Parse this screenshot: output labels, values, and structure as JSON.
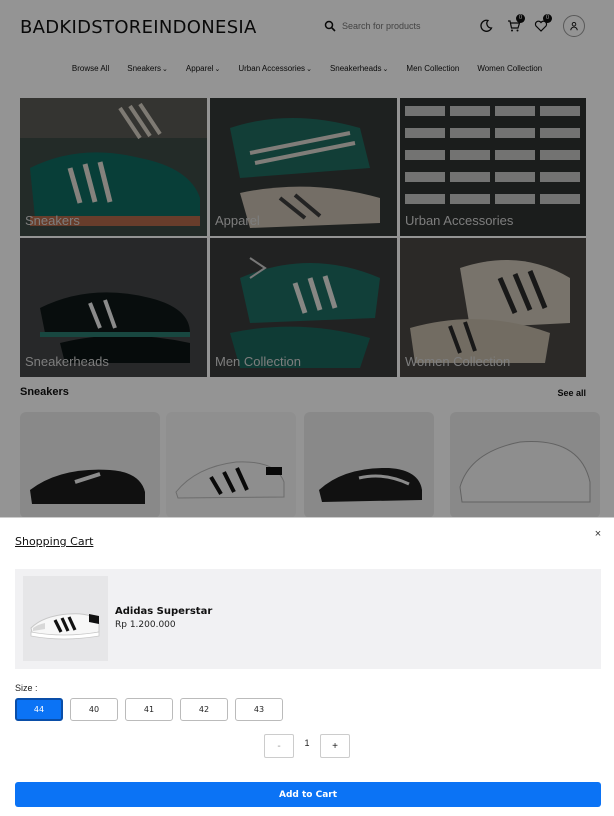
{
  "header": {
    "brand": "BADKIDSTOREINDONESIA",
    "search_placeholder": "Search for products",
    "cart_count": "0",
    "wishlist_count": "0"
  },
  "nav": {
    "items": [
      {
        "label": "Browse All",
        "dropdown": false
      },
      {
        "label": "Sneakers",
        "dropdown": true
      },
      {
        "label": "Apparel",
        "dropdown": true
      },
      {
        "label": "Urban Accessories",
        "dropdown": true
      },
      {
        "label": "Sneakerheads",
        "dropdown": true
      },
      {
        "label": "Men Collection",
        "dropdown": false
      },
      {
        "label": "Women Collection",
        "dropdown": false
      }
    ],
    "chevron": "⌄"
  },
  "categories": [
    {
      "label": "Sneakers"
    },
    {
      "label": "Apparel"
    },
    {
      "label": "Urban Accessories"
    },
    {
      "label": "Sneakerheads"
    },
    {
      "label": "Men Collection"
    },
    {
      "label": "Women Collection"
    }
  ],
  "section": {
    "title": "Sneakers",
    "see_all": "See all"
  },
  "cart": {
    "title": "Shopping Cart",
    "close": "×",
    "item": {
      "name": "Adidas Superstar",
      "price": "Rp 1.200.000"
    },
    "size_label": "Size :",
    "sizes": [
      "44",
      "40",
      "41",
      "42",
      "43"
    ],
    "selected_size": "44",
    "quantity": "1",
    "minus": "-",
    "plus": "+",
    "add_button": "Add to Cart"
  },
  "colors": {
    "accent": "#0b73f5",
    "overlay": "rgba(0,0,0,0.42)"
  }
}
